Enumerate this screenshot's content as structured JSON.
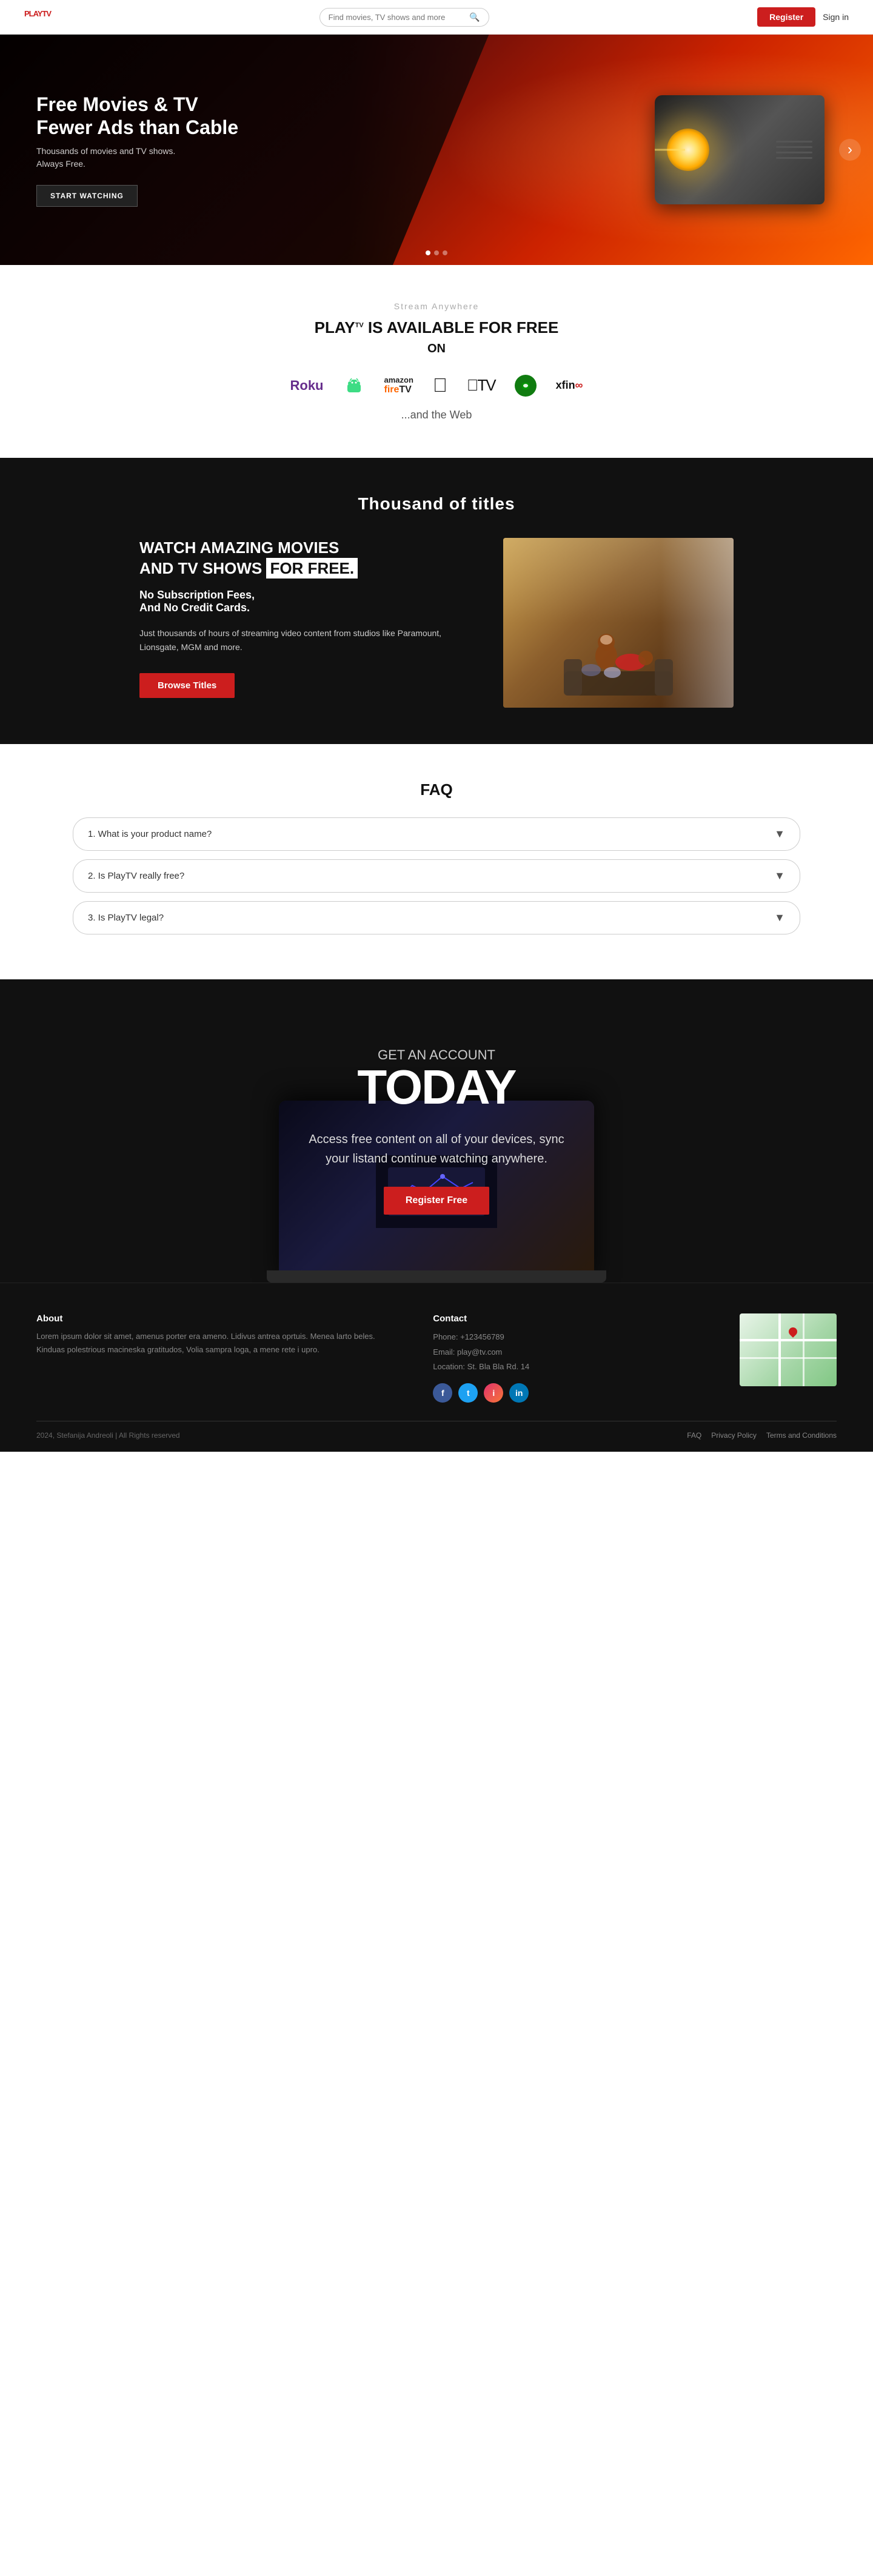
{
  "navbar": {
    "logo_play": "PLAY",
    "logo_tv": "TV",
    "search_placeholder": "Find movies, TV shows and more",
    "register_label": "Register",
    "signin_label": "Sign in"
  },
  "hero": {
    "title": "Free Movies & TV\nFewer Ads than Cable",
    "subtitle": "Thousands of movies and TV shows.\nAlways Free.",
    "cta_label": "START WATCHING",
    "dots": [
      1,
      2,
      3
    ],
    "arrow": "›"
  },
  "platforms": {
    "subtitle": "Stream Anywhere",
    "title_prefix": "PLAY",
    "title_tv": "TV",
    "title_suffix": " IS AVAILABLE FOR FREE",
    "on_label": "ON",
    "items": [
      {
        "name": "Roku",
        "icon": "roku"
      },
      {
        "name": "Android",
        "icon": "android"
      },
      {
        "name": "Amazon Fire TV",
        "icon": "amazon"
      },
      {
        "name": "Apple",
        "icon": "apple"
      },
      {
        "name": "Apple TV",
        "icon": "appletv"
      },
      {
        "name": "Xbox",
        "icon": "xbox"
      },
      {
        "name": "Xfinity",
        "icon": "xfinity"
      }
    ],
    "web_text": "...and the Web"
  },
  "thousands": {
    "heading": "Thousand of titles",
    "watch_title_1": "WATCH AMAZING MOVIES",
    "watch_title_2": "AND TV SHOWS ",
    "watch_highlight": "FOR FREE.",
    "watch_sub_1": "No Subscription Fees,",
    "watch_sub_2": "And No Credit Cards.",
    "watch_desc": "Just thousands of hours of streaming video content from studios like Paramount, Lionsgate, MGM and more.",
    "browse_label": "Browse Titles"
  },
  "faq": {
    "heading": "FAQ",
    "items": [
      {
        "id": 1,
        "question": "1. What is your product name?"
      },
      {
        "id": 2,
        "question": "2. Is PlayTV really free?"
      },
      {
        "id": 3,
        "question": "3. Is PlayTV legal?"
      }
    ]
  },
  "cta": {
    "pre_title": "GET AN ACCOUNT",
    "title": "TODAY",
    "description": "Access free content on all of your devices, sync your listand continue watching anywhere.",
    "register_label": "Register Free"
  },
  "footer": {
    "about_title": "About",
    "about_text": "Lorem ipsum dolor sit amet, amenus porter era ameno. Lidivus antrea oprtuis. Menea larto beles. Kinduas polestrious macineska gratitudos, Volia sampra loga, a mene rete i upro.",
    "contact_title": "Contact",
    "phone": "Phone: +123456789",
    "email": "Email: play@tv.com",
    "location": "Location: St. Bla Bla Rd. 14",
    "social": [
      {
        "name": "Facebook",
        "class": "fb",
        "icon": "f"
      },
      {
        "name": "Twitter",
        "class": "tw",
        "icon": "t"
      },
      {
        "name": "Instagram",
        "class": "ig",
        "icon": "i"
      },
      {
        "name": "LinkedIn",
        "class": "li",
        "icon": "in"
      }
    ],
    "copyright": "2024, Stefanija Andreoli | All Rights reserved",
    "links": [
      "FAQ",
      "Privacy Policy",
      "Terms and Conditions"
    ]
  }
}
